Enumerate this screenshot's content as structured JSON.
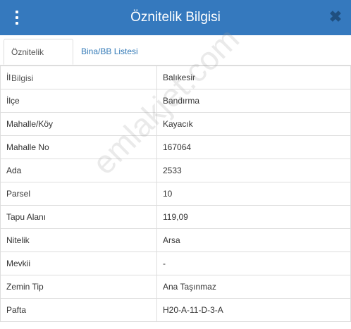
{
  "header": {
    "title": "Öznitelik Bilgisi"
  },
  "tabs": [
    {
      "label": "Öznitelik Bilgisi"
    },
    {
      "label": "Bina/BB Listesi"
    }
  ],
  "rows": [
    {
      "key": "İl",
      "value": "Balıkesir"
    },
    {
      "key": "İlçe",
      "value": "Bandırma"
    },
    {
      "key": "Mahalle/Köy",
      "value": "Kayacık"
    },
    {
      "key": "Mahalle No",
      "value": "167064"
    },
    {
      "key": "Ada",
      "value": "2533"
    },
    {
      "key": "Parsel",
      "value": "10"
    },
    {
      "key": "Tapu Alanı",
      "value": "119,09"
    },
    {
      "key": "Nitelik",
      "value": "Arsa"
    },
    {
      "key": "Mevkii",
      "value": "-"
    },
    {
      "key": "Zemin Tip",
      "value": "Ana Taşınmaz"
    },
    {
      "key": "Pafta",
      "value": "H20-A-11-D-3-A"
    }
  ],
  "watermark": "emlakjet.com",
  "colors": {
    "header_bg": "#3579be",
    "tab_link": "#337ab7"
  }
}
